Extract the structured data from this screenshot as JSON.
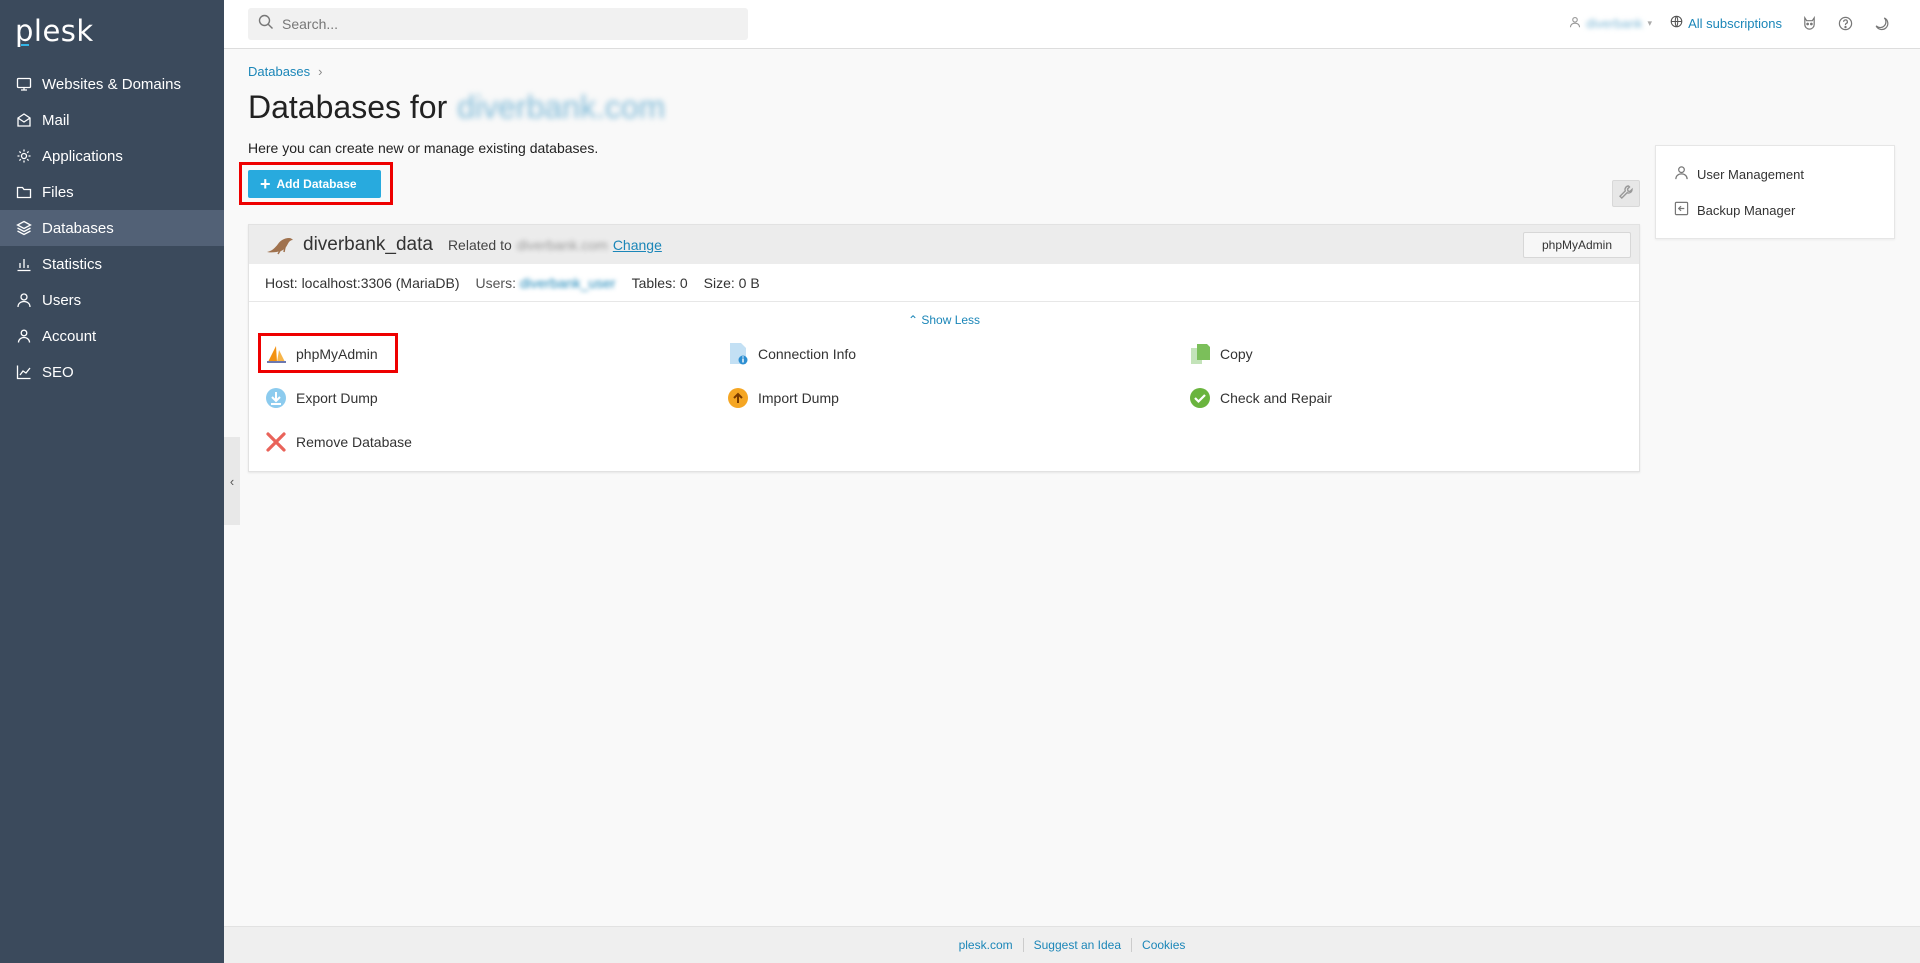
{
  "brand": {
    "logo_text": "plesk",
    "accent": "#33b4e6"
  },
  "sidebar": {
    "items": [
      {
        "label": "Websites & Domains",
        "icon": "monitor-icon",
        "active": false
      },
      {
        "label": "Mail",
        "icon": "envelope-icon",
        "active": false
      },
      {
        "label": "Applications",
        "icon": "gear-icon",
        "active": false
      },
      {
        "label": "Files",
        "icon": "folder-icon",
        "active": false
      },
      {
        "label": "Databases",
        "icon": "layers-icon",
        "active": true
      },
      {
        "label": "Statistics",
        "icon": "bar-chart-icon",
        "active": false
      },
      {
        "label": "Users",
        "icon": "user-icon",
        "active": false
      },
      {
        "label": "Account",
        "icon": "account-icon",
        "active": false
      },
      {
        "label": "SEO",
        "icon": "seo-chart-icon",
        "active": false
      }
    ],
    "bg_color": "#3b4a5c",
    "active_color": "#526176"
  },
  "topbar": {
    "search_placeholder": "Search...",
    "user_name": "diverbank",
    "subscriptions_label": "All subscriptions"
  },
  "breadcrumb": {
    "item": "Databases"
  },
  "page": {
    "title_prefix": "Databases for",
    "title_domain": "diverbank.com",
    "intro": "Here you can create new or manage existing databases."
  },
  "toolbar": {
    "add_database_label": "Add Database"
  },
  "database": {
    "name": "diverbank_data",
    "related_prefix": "Related to",
    "related_domain": "diverbank.com",
    "change_label": "Change",
    "phpmyadmin_button": "phpMyAdmin",
    "host_label": "Host: localhost:3306 (MariaDB)",
    "users_label": "Users:",
    "users_value": "diverbank_user",
    "tables_label": "Tables:",
    "tables_value": "0",
    "size_label": "Size:",
    "size_value": "0 B",
    "show_less_label": "Show Less",
    "actions": [
      {
        "label": "phpMyAdmin",
        "icon": "phpmyadmin-sail-icon"
      },
      {
        "label": "Connection Info",
        "icon": "connection-info-icon"
      },
      {
        "label": "Copy",
        "icon": "copy-icon"
      },
      {
        "label": "Export Dump",
        "icon": "export-dump-icon"
      },
      {
        "label": "Import Dump",
        "icon": "import-dump-icon"
      },
      {
        "label": "Check and Repair",
        "icon": "check-icon"
      },
      {
        "label": "Remove Database",
        "icon": "remove-x-icon"
      }
    ]
  },
  "side_panel": {
    "items": [
      {
        "label": "User Management",
        "icon": "user-icon"
      },
      {
        "label": "Backup Manager",
        "icon": "backup-icon"
      }
    ]
  },
  "footer": {
    "links": [
      "plesk.com",
      "Suggest an Idea",
      "Cookies"
    ]
  }
}
